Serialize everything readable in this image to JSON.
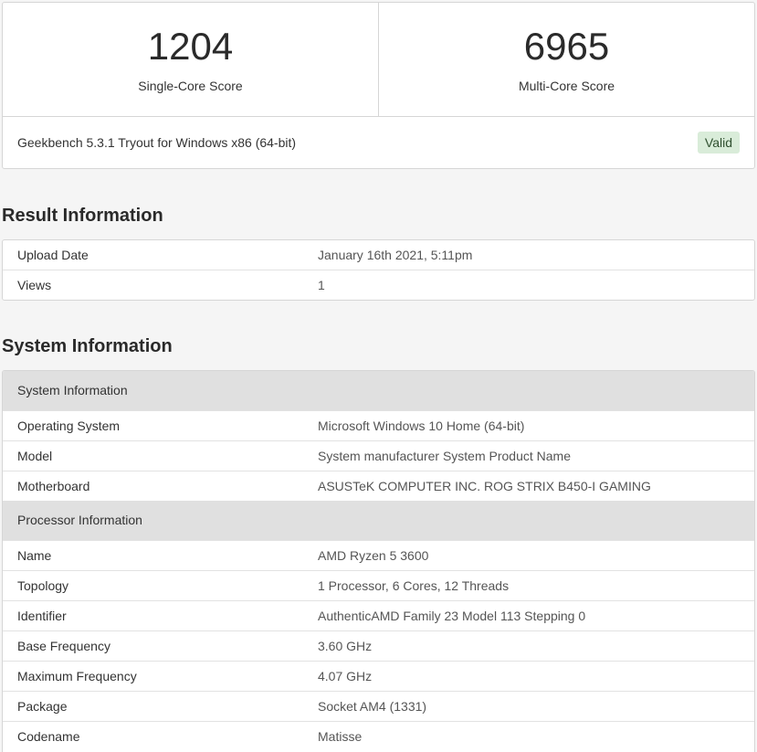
{
  "scores": {
    "single": {
      "value": "1204",
      "label": "Single-Core Score"
    },
    "multi": {
      "value": "6965",
      "label": "Multi-Core Score"
    },
    "version": "Geekbench 5.3.1 Tryout for Windows x86 (64-bit)",
    "status": "Valid"
  },
  "result_info": {
    "title": "Result Information",
    "rows": [
      {
        "key": "Upload Date",
        "value": "January 16th 2021, 5:11pm"
      },
      {
        "key": "Views",
        "value": "1"
      }
    ]
  },
  "system_info": {
    "title": "System Information",
    "group1": "System Information",
    "sys_rows": [
      {
        "key": "Operating System",
        "value": "Microsoft Windows 10 Home (64-bit)"
      },
      {
        "key": "Model",
        "value": "System manufacturer System Product Name"
      },
      {
        "key": "Motherboard",
        "value": "ASUSTeK COMPUTER INC. ROG STRIX B450-I GAMING"
      }
    ],
    "group2": "Processor Information",
    "proc_rows": [
      {
        "key": "Name",
        "value": "AMD Ryzen 5 3600"
      },
      {
        "key": "Topology",
        "value": "1 Processor, 6 Cores, 12 Threads"
      },
      {
        "key": "Identifier",
        "value": "AuthenticAMD Family 23 Model 113 Stepping 0"
      },
      {
        "key": "Base Frequency",
        "value": "3.60 GHz"
      },
      {
        "key": "Maximum Frequency",
        "value": "4.07 GHz"
      },
      {
        "key": "Package",
        "value": "Socket AM4 (1331)"
      },
      {
        "key": "Codename",
        "value": "Matisse"
      }
    ]
  },
  "colors": {
    "background": "#f5f5f5",
    "group_header": "#e0e0e0",
    "valid_badge": "#d9ecd9"
  }
}
